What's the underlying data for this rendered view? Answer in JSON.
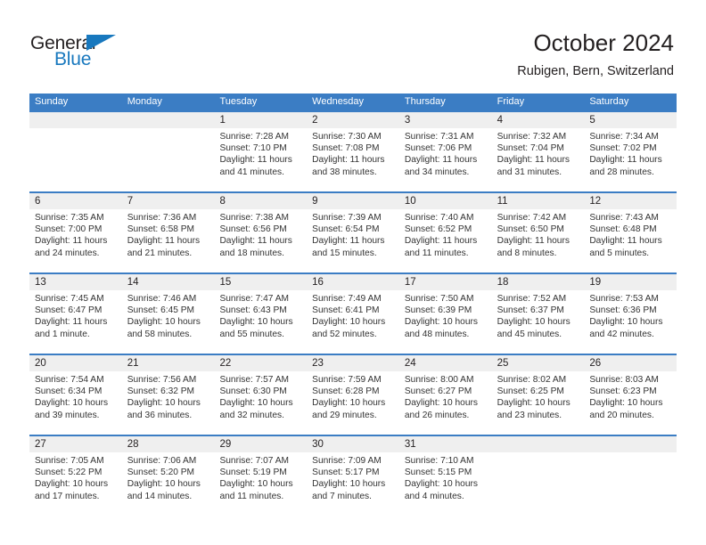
{
  "brand": {
    "name_top": "General",
    "name_bottom": "Blue",
    "color_dark": "#231f20",
    "color_blue": "#1878be"
  },
  "header": {
    "title": "October 2024",
    "subtitle": "Rubigen, Bern, Switzerland"
  },
  "theme": {
    "header_blue": "#3b7dc4",
    "daystrip_gray": "#efefef",
    "text": "#231f20"
  },
  "weekdays": [
    "Sunday",
    "Monday",
    "Tuesday",
    "Wednesday",
    "Thursday",
    "Friday",
    "Saturday"
  ],
  "weeks": [
    [
      {
        "day": "",
        "sunrise": "",
        "sunset": "",
        "daylight1": "",
        "daylight2": ""
      },
      {
        "day": "",
        "sunrise": "",
        "sunset": "",
        "daylight1": "",
        "daylight2": ""
      },
      {
        "day": "1",
        "sunrise": "Sunrise: 7:28 AM",
        "sunset": "Sunset: 7:10 PM",
        "daylight1": "Daylight: 11 hours",
        "daylight2": "and 41 minutes."
      },
      {
        "day": "2",
        "sunrise": "Sunrise: 7:30 AM",
        "sunset": "Sunset: 7:08 PM",
        "daylight1": "Daylight: 11 hours",
        "daylight2": "and 38 minutes."
      },
      {
        "day": "3",
        "sunrise": "Sunrise: 7:31 AM",
        "sunset": "Sunset: 7:06 PM",
        "daylight1": "Daylight: 11 hours",
        "daylight2": "and 34 minutes."
      },
      {
        "day": "4",
        "sunrise": "Sunrise: 7:32 AM",
        "sunset": "Sunset: 7:04 PM",
        "daylight1": "Daylight: 11 hours",
        "daylight2": "and 31 minutes."
      },
      {
        "day": "5",
        "sunrise": "Sunrise: 7:34 AM",
        "sunset": "Sunset: 7:02 PM",
        "daylight1": "Daylight: 11 hours",
        "daylight2": "and 28 minutes."
      }
    ],
    [
      {
        "day": "6",
        "sunrise": "Sunrise: 7:35 AM",
        "sunset": "Sunset: 7:00 PM",
        "daylight1": "Daylight: 11 hours",
        "daylight2": "and 24 minutes."
      },
      {
        "day": "7",
        "sunrise": "Sunrise: 7:36 AM",
        "sunset": "Sunset: 6:58 PM",
        "daylight1": "Daylight: 11 hours",
        "daylight2": "and 21 minutes."
      },
      {
        "day": "8",
        "sunrise": "Sunrise: 7:38 AM",
        "sunset": "Sunset: 6:56 PM",
        "daylight1": "Daylight: 11 hours",
        "daylight2": "and 18 minutes."
      },
      {
        "day": "9",
        "sunrise": "Sunrise: 7:39 AM",
        "sunset": "Sunset: 6:54 PM",
        "daylight1": "Daylight: 11 hours",
        "daylight2": "and 15 minutes."
      },
      {
        "day": "10",
        "sunrise": "Sunrise: 7:40 AM",
        "sunset": "Sunset: 6:52 PM",
        "daylight1": "Daylight: 11 hours",
        "daylight2": "and 11 minutes."
      },
      {
        "day": "11",
        "sunrise": "Sunrise: 7:42 AM",
        "sunset": "Sunset: 6:50 PM",
        "daylight1": "Daylight: 11 hours",
        "daylight2": "and 8 minutes."
      },
      {
        "day": "12",
        "sunrise": "Sunrise: 7:43 AM",
        "sunset": "Sunset: 6:48 PM",
        "daylight1": "Daylight: 11 hours",
        "daylight2": "and 5 minutes."
      }
    ],
    [
      {
        "day": "13",
        "sunrise": "Sunrise: 7:45 AM",
        "sunset": "Sunset: 6:47 PM",
        "daylight1": "Daylight: 11 hours",
        "daylight2": "and 1 minute."
      },
      {
        "day": "14",
        "sunrise": "Sunrise: 7:46 AM",
        "sunset": "Sunset: 6:45 PM",
        "daylight1": "Daylight: 10 hours",
        "daylight2": "and 58 minutes."
      },
      {
        "day": "15",
        "sunrise": "Sunrise: 7:47 AM",
        "sunset": "Sunset: 6:43 PM",
        "daylight1": "Daylight: 10 hours",
        "daylight2": "and 55 minutes."
      },
      {
        "day": "16",
        "sunrise": "Sunrise: 7:49 AM",
        "sunset": "Sunset: 6:41 PM",
        "daylight1": "Daylight: 10 hours",
        "daylight2": "and 52 minutes."
      },
      {
        "day": "17",
        "sunrise": "Sunrise: 7:50 AM",
        "sunset": "Sunset: 6:39 PM",
        "daylight1": "Daylight: 10 hours",
        "daylight2": "and 48 minutes."
      },
      {
        "day": "18",
        "sunrise": "Sunrise: 7:52 AM",
        "sunset": "Sunset: 6:37 PM",
        "daylight1": "Daylight: 10 hours",
        "daylight2": "and 45 minutes."
      },
      {
        "day": "19",
        "sunrise": "Sunrise: 7:53 AM",
        "sunset": "Sunset: 6:36 PM",
        "daylight1": "Daylight: 10 hours",
        "daylight2": "and 42 minutes."
      }
    ],
    [
      {
        "day": "20",
        "sunrise": "Sunrise: 7:54 AM",
        "sunset": "Sunset: 6:34 PM",
        "daylight1": "Daylight: 10 hours",
        "daylight2": "and 39 minutes."
      },
      {
        "day": "21",
        "sunrise": "Sunrise: 7:56 AM",
        "sunset": "Sunset: 6:32 PM",
        "daylight1": "Daylight: 10 hours",
        "daylight2": "and 36 minutes."
      },
      {
        "day": "22",
        "sunrise": "Sunrise: 7:57 AM",
        "sunset": "Sunset: 6:30 PM",
        "daylight1": "Daylight: 10 hours",
        "daylight2": "and 32 minutes."
      },
      {
        "day": "23",
        "sunrise": "Sunrise: 7:59 AM",
        "sunset": "Sunset: 6:28 PM",
        "daylight1": "Daylight: 10 hours",
        "daylight2": "and 29 minutes."
      },
      {
        "day": "24",
        "sunrise": "Sunrise: 8:00 AM",
        "sunset": "Sunset: 6:27 PM",
        "daylight1": "Daylight: 10 hours",
        "daylight2": "and 26 minutes."
      },
      {
        "day": "25",
        "sunrise": "Sunrise: 8:02 AM",
        "sunset": "Sunset: 6:25 PM",
        "daylight1": "Daylight: 10 hours",
        "daylight2": "and 23 minutes."
      },
      {
        "day": "26",
        "sunrise": "Sunrise: 8:03 AM",
        "sunset": "Sunset: 6:23 PM",
        "daylight1": "Daylight: 10 hours",
        "daylight2": "and 20 minutes."
      }
    ],
    [
      {
        "day": "27",
        "sunrise": "Sunrise: 7:05 AM",
        "sunset": "Sunset: 5:22 PM",
        "daylight1": "Daylight: 10 hours",
        "daylight2": "and 17 minutes."
      },
      {
        "day": "28",
        "sunrise": "Sunrise: 7:06 AM",
        "sunset": "Sunset: 5:20 PM",
        "daylight1": "Daylight: 10 hours",
        "daylight2": "and 14 minutes."
      },
      {
        "day": "29",
        "sunrise": "Sunrise: 7:07 AM",
        "sunset": "Sunset: 5:19 PM",
        "daylight1": "Daylight: 10 hours",
        "daylight2": "and 11 minutes."
      },
      {
        "day": "30",
        "sunrise": "Sunrise: 7:09 AM",
        "sunset": "Sunset: 5:17 PM",
        "daylight1": "Daylight: 10 hours",
        "daylight2": "and 7 minutes."
      },
      {
        "day": "31",
        "sunrise": "Sunrise: 7:10 AM",
        "sunset": "Sunset: 5:15 PM",
        "daylight1": "Daylight: 10 hours",
        "daylight2": "and 4 minutes."
      },
      {
        "day": "",
        "sunrise": "",
        "sunset": "",
        "daylight1": "",
        "daylight2": ""
      },
      {
        "day": "",
        "sunrise": "",
        "sunset": "",
        "daylight1": "",
        "daylight2": ""
      }
    ]
  ]
}
